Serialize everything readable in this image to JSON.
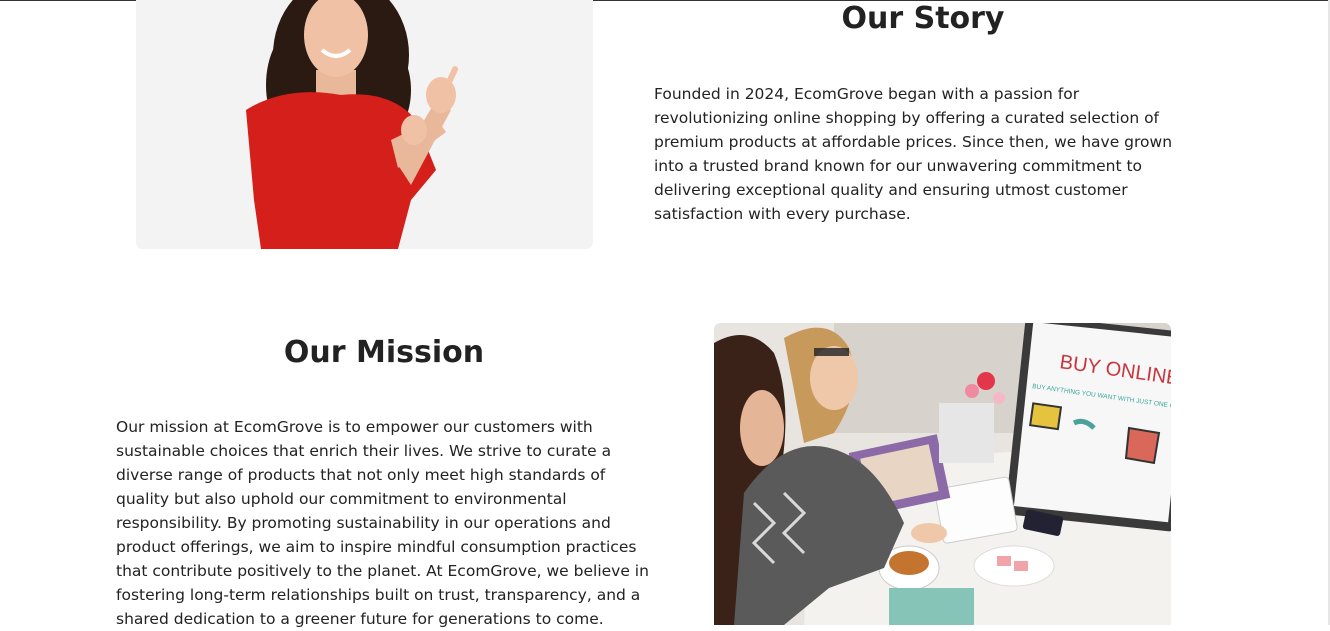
{
  "story": {
    "title": "Our Story",
    "text": "Founded in 2024, EcomGrove began with a passion for revolutionizing online shopping by offering a curated selection of premium products at affordable prices. Since then, we have grown into a trusted brand known for our unwavering commitment to delivering exceptional quality and ensuring utmost customer satisfaction with every purchase.",
    "image_alt": "woman-pointing-photo"
  },
  "mission": {
    "title": "Our Mission",
    "text": "Our mission at EcomGrove is to empower our customers with sustainable choices that enrich their lives. We strive to curate a diverse range of products that not only meet high standards of quality but also uphold our commitment to environmental responsibility. By promoting sustainability in our operations and product offerings, we aim to inspire mindful consumption practices that contribute positively to the planet. At EcomGrove, we believe in fostering long-term relationships built on trust, transparency, and a shared dedication to a greener future for generations to come.",
    "image_alt": "women-shopping-online-photo",
    "screen_heading": "BUY ONLINE",
    "screen_subtext": "BUY ANYTHING YOU WANT WITH JUST ONE CLICK"
  },
  "colors": {
    "text": "#222222",
    "shirt_red": "#d41f1a",
    "image_bg": "#f2f2f2"
  }
}
